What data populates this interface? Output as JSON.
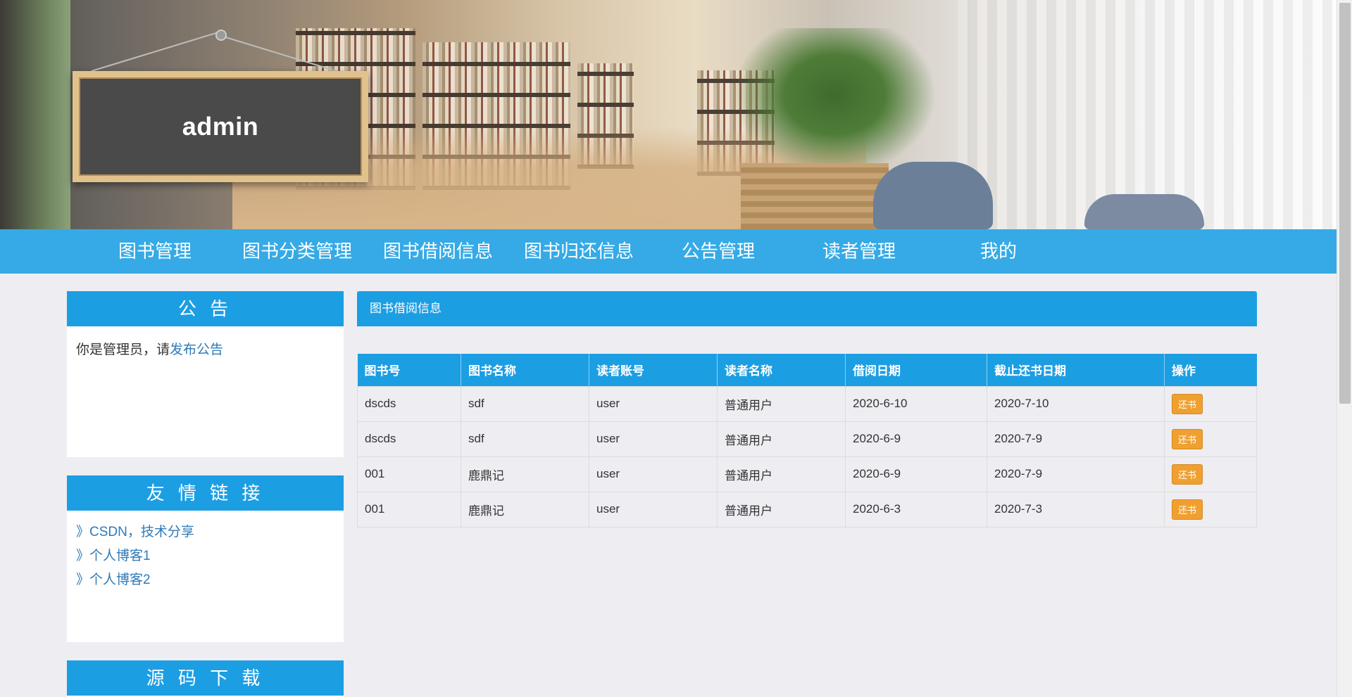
{
  "header": {
    "board_title": "admin"
  },
  "nav": {
    "items": [
      "图书管理",
      "图书分类管理",
      "图书借阅信息",
      "图书归还信息",
      "公告管理",
      "读者管理",
      "我的"
    ]
  },
  "sidebar": {
    "notice": {
      "title": "公 告",
      "text_prefix": "你是管理员，请",
      "link_text": "发布公告"
    },
    "friends": {
      "title": "友 情 链 接",
      "links": [
        "》CSDN，技术分享",
        "》个人博客1",
        "》个人博客2"
      ]
    },
    "source": {
      "title": "源 码 下 载"
    }
  },
  "main": {
    "title": "图书借阅信息",
    "table": {
      "headers": [
        "图书号",
        "图书名称",
        "读者账号",
        "读者名称",
        "借阅日期",
        "截止还书日期",
        "操作"
      ],
      "rows": [
        [
          "dscds",
          "sdf",
          "user",
          "普通用户",
          "2020-6-10",
          "2020-7-10"
        ],
        [
          "dscds",
          "sdf",
          "user",
          "普通用户",
          "2020-6-9",
          "2020-7-9"
        ],
        [
          "001",
          "鹿鼎记",
          "user",
          "普通用户",
          "2020-6-9",
          "2020-7-9"
        ],
        [
          "001",
          "鹿鼎记",
          "user",
          "普通用户",
          "2020-6-3",
          "2020-7-3"
        ]
      ],
      "action_label": "还书"
    }
  },
  "colors": {
    "primary": "#1c9ee3",
    "action": "#f0a030",
    "link": "#2f7ab8",
    "background": "#eeedf2"
  }
}
